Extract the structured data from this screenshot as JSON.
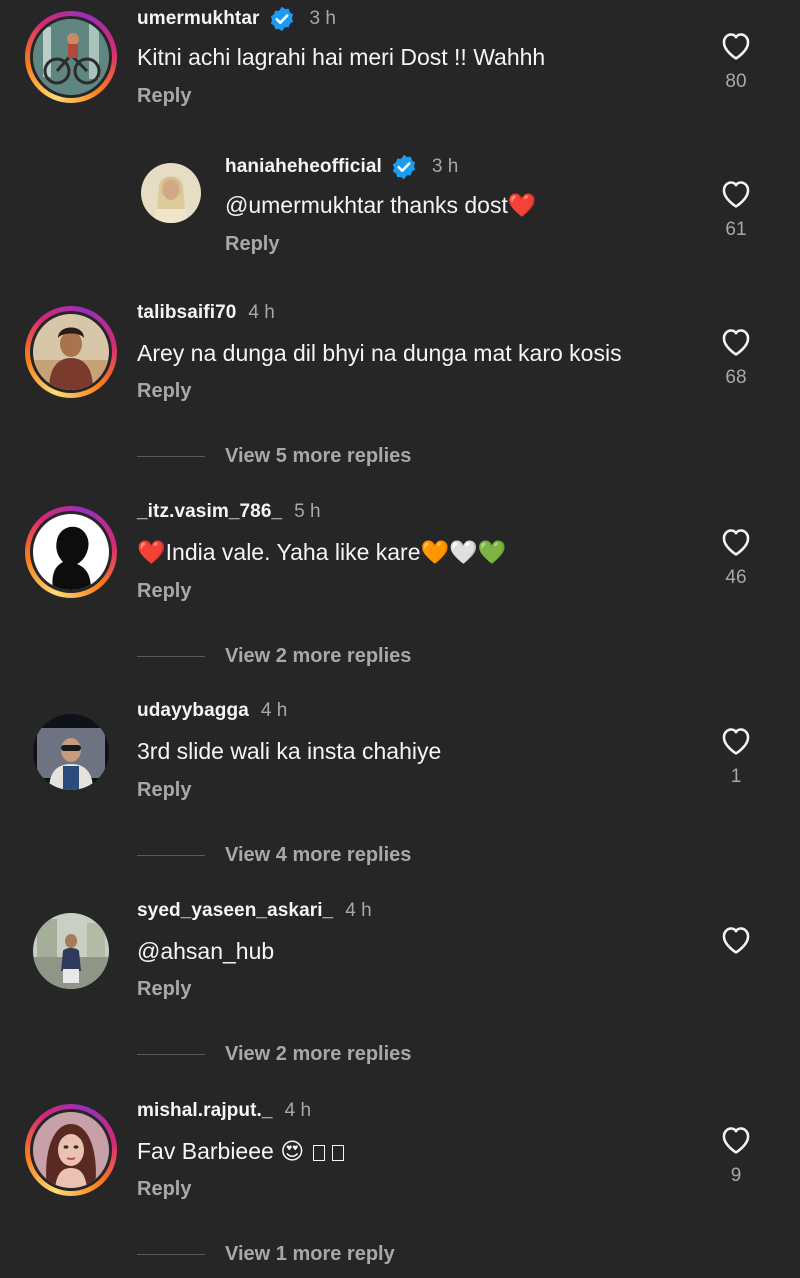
{
  "comments": [
    {
      "username": "umermukhtar",
      "verified": true,
      "time": "3 h",
      "text": "Kitni achi lagrahi hai meri Dost !! Wahhh",
      "reply_label": "Reply",
      "likes": "80",
      "story_ring": true,
      "avatar_colors": [
        "#6a8f8c",
        "#3f5f5a"
      ]
    },
    {
      "username": "haniaheheofficial",
      "verified": true,
      "time": "3 h",
      "text": "@umermukhtar thanks dost❤️",
      "reply_label": "Reply",
      "likes": "61",
      "story_ring": false,
      "avatar_colors": [
        "#d8c6a8",
        "#8a7a5e"
      ]
    },
    {
      "username": "talibsaifi70",
      "verified": false,
      "time": "4 h",
      "text": "Arey na dunga dil bhyi na dunga mat karo kosis",
      "reply_label": "Reply",
      "likes": "68",
      "story_ring": true,
      "avatar_colors": [
        "#c8a27a",
        "#6b3f2a"
      ],
      "view_more": "View 5 more replies"
    },
    {
      "username": "_itz.vasim_786_",
      "verified": false,
      "time": "5 h",
      "text": "❤️India vale. Yaha like kare🧡🤍💚",
      "reply_label": "Reply",
      "likes": "46",
      "story_ring": true,
      "avatar_colors": [
        "#ffffff",
        "#111111"
      ],
      "view_more": "View 2 more replies"
    },
    {
      "username": "udayybagga",
      "verified": false,
      "time": "4 h",
      "text": "3rd slide wali ka insta chahiye",
      "reply_label": "Reply",
      "likes": "1",
      "story_ring": false,
      "avatar_colors": [
        "#8a8f96",
        "#2d3a4e"
      ],
      "view_more": "View 4 more replies"
    },
    {
      "username": "syed_yaseen_askari_",
      "verified": false,
      "time": "4 h",
      "text": "@ahsan_hub",
      "reply_label": "Reply",
      "likes": "",
      "story_ring": false,
      "avatar_colors": [
        "#b9c1b0",
        "#3f4a3a"
      ],
      "view_more": "View 2 more replies"
    },
    {
      "username": "mishal.rajput._",
      "verified": false,
      "time": "4 h",
      "text": "Fav Barbieee 😍",
      "reply_label": "Reply",
      "likes": "9",
      "story_ring": true,
      "avatar_colors": [
        "#e8a0a8",
        "#7a3a4a"
      ],
      "view_more": "View 1 more reply"
    }
  ],
  "icons": {
    "like": "heart-outline-icon",
    "verified": "verified-badge-icon"
  },
  "colors": {
    "background": "#262626",
    "primary_text": "#f5f5f5",
    "secondary_text": "#a8a8a8",
    "verified_blue": "#1d9bf0"
  }
}
